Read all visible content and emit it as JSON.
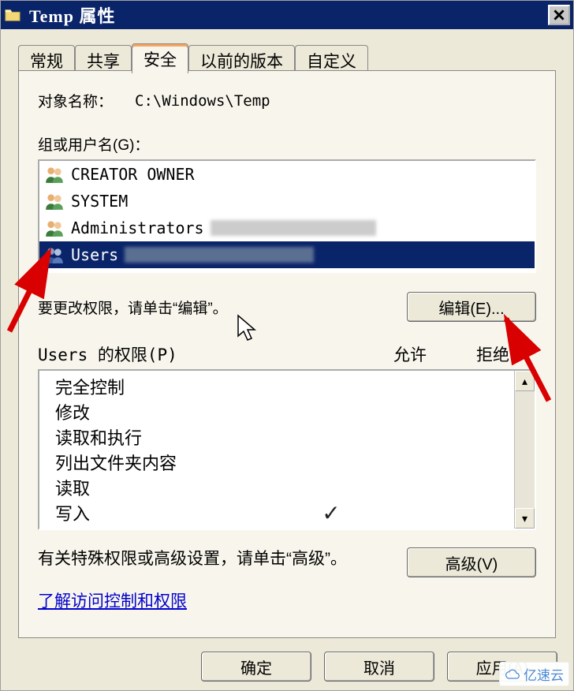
{
  "window": {
    "title": "Temp 属性"
  },
  "tabs": {
    "general": "常规",
    "share": "共享",
    "security": "安全",
    "prev_versions": "以前的版本",
    "custom": "自定义"
  },
  "security": {
    "object_label": "对象名称：",
    "object_path": "C:\\Windows\\Temp",
    "groups_label": "组或用户名(G)：",
    "users": [
      {
        "name": "CREATOR OWNER",
        "type": "user"
      },
      {
        "name": "SYSTEM",
        "type": "user"
      },
      {
        "name": "Administrators",
        "type": "group",
        "redacted": true
      },
      {
        "name": "Users",
        "type": "group",
        "redacted": true,
        "selected": true
      }
    ],
    "change_text": "要更改权限，请单击“编辑”。",
    "edit_button": "编辑(E)...",
    "perm_label": "Users 的权限(P)",
    "allow_col": "允许",
    "deny_col": "拒绝",
    "permissions": [
      {
        "name": "完全控制",
        "allow": false,
        "deny": false
      },
      {
        "name": "修改",
        "allow": false,
        "deny": false
      },
      {
        "name": "读取和执行",
        "allow": false,
        "deny": false
      },
      {
        "name": "列出文件夹内容",
        "allow": false,
        "deny": false
      },
      {
        "name": "读取",
        "allow": false,
        "deny": false
      },
      {
        "name": "写入",
        "allow": true,
        "deny": false
      }
    ],
    "advanced_text": "有关特殊权限或高级设置，请单击“高级”。",
    "advanced_button": "高级(V)",
    "link_text": "了解访问控制和权限"
  },
  "footer": {
    "ok": "确定",
    "cancel": "取消",
    "apply": "应用(A)"
  },
  "watermark": "亿速云"
}
